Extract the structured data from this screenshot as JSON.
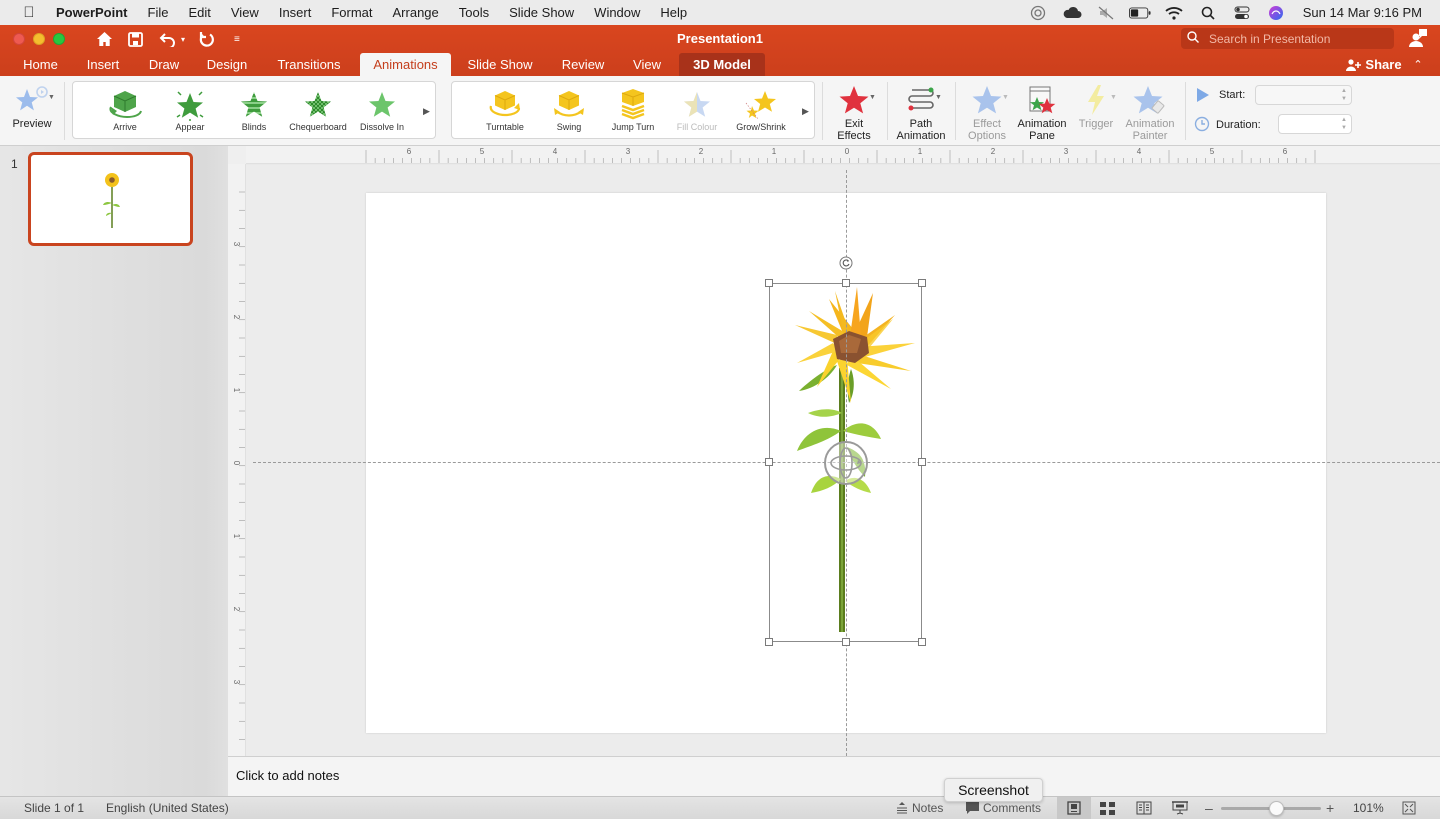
{
  "menubar": {
    "app_name": "PowerPoint",
    "items": [
      "File",
      "Edit",
      "View",
      "Insert",
      "Format",
      "Arrange",
      "Tools",
      "Slide Show",
      "Window",
      "Help"
    ],
    "clock": "Sun 14 Mar  9:16 PM"
  },
  "titlebar": {
    "title": "Presentation1",
    "search_placeholder": "Search in Presentation",
    "share_label": "Share"
  },
  "tabs": [
    {
      "label": "Home"
    },
    {
      "label": "Insert"
    },
    {
      "label": "Draw"
    },
    {
      "label": "Design"
    },
    {
      "label": "Transitions"
    },
    {
      "label": "Animations",
      "active": true
    },
    {
      "label": "Slide Show"
    },
    {
      "label": "Review"
    },
    {
      "label": "View"
    },
    {
      "label": "3D Model",
      "contextual": true
    }
  ],
  "ribbon": {
    "preview_label": "Preview",
    "entrance_gallery": [
      "Arrive",
      "Appear",
      "Blinds",
      "Chequerboard",
      "Dissolve In"
    ],
    "emphasis_gallery": [
      "Turntable",
      "Swing",
      "Jump  Turn",
      "Fill Colour",
      "Grow/Shrink"
    ],
    "exit_effects": [
      "Exit",
      "Effects"
    ],
    "path_animation": [
      "Path",
      "Animation"
    ],
    "effect_options": [
      "Effect",
      "Options"
    ],
    "animation_pane": [
      "Animation",
      "Pane"
    ],
    "trigger": "Trigger",
    "animation_painter": [
      "Animation",
      "Painter"
    ],
    "start_label": "Start:",
    "start_value": "",
    "duration_label": "Duration:",
    "duration_value": ""
  },
  "thumbnails": {
    "slide_number": "1"
  },
  "rulers": {
    "horizontal_ticks": [
      "6",
      "5",
      "4",
      "3",
      "2",
      "1",
      "0",
      "1",
      "2",
      "3",
      "4",
      "5",
      "6"
    ],
    "vertical_ticks": [
      "3",
      "2",
      "1",
      "0",
      "1",
      "2",
      "3"
    ]
  },
  "notes": {
    "placeholder": "Click to add notes"
  },
  "statusbar": {
    "slide_info": "Slide 1 of 1",
    "language": "English (United States)",
    "notes_label": "Notes",
    "comments_label": "Comments",
    "zoom_level": "101%",
    "zoom_fraction": 0.55
  },
  "tooltip": "Screenshot",
  "colors": {
    "brand": "#c9441f",
    "titlebar": "#d9461f",
    "contextual_tab": "#a8321a"
  }
}
